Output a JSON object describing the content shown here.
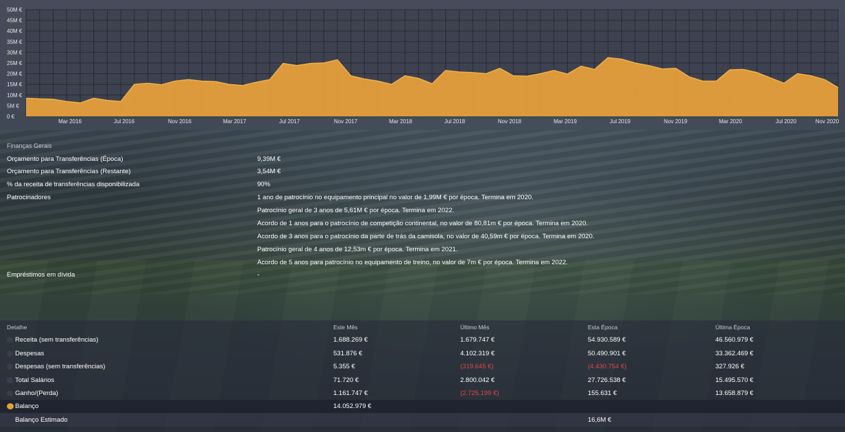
{
  "chart_data": {
    "type": "area",
    "y_ticks": [
      "50M €",
      "45M €",
      "40M €",
      "35M €",
      "30M €",
      "25M €",
      "20M €",
      "15M €",
      "10M €",
      "5M €",
      "0 €"
    ],
    "x_ticks": [
      "Mar 2016",
      "Jul 2016",
      "Nov 2016",
      "Mar 2017",
      "Jul 2017",
      "Nov 2017",
      "Mar 2018",
      "Jul 2018",
      "Nov 2018",
      "Mar 2019",
      "Jul 2019",
      "Nov 2019",
      "Mar 2020",
      "Jul 2020",
      "Nov 2020"
    ],
    "ylim": [
      0,
      50
    ],
    "y_unit": "M €",
    "values": [
      8.5,
      8.2,
      8.0,
      7.0,
      6.3,
      8.5,
      7.5,
      7.0,
      15.0,
      15.5,
      14.8,
      16.5,
      17.2,
      16.5,
      16.3,
      15.0,
      14.5,
      16.0,
      17.2,
      24.8,
      23.8,
      24.8,
      25.0,
      26.5,
      19.0,
      17.5,
      16.5,
      15.0,
      19.0,
      17.8,
      15.3,
      21.5,
      20.8,
      20.5,
      20.0,
      22.5,
      19.0,
      18.8,
      20.0,
      21.5,
      19.8,
      23.5,
      22.0,
      27.5,
      26.8,
      25.0,
      23.8,
      22.2,
      22.5,
      18.5,
      16.5,
      16.5,
      21.8,
      22.0,
      20.5,
      18.0,
      15.5,
      20.0,
      19.0,
      17.2,
      13.5
    ],
    "fill_color": "#e9a23b",
    "grid": true
  },
  "finances": {
    "header": "Finanças Gerais",
    "rows": [
      {
        "label": "Orçamento para Transferências (Época)",
        "value": "9,39M €"
      },
      {
        "label": "Orçamento para Transferências (Restante)",
        "value": "3,54M €"
      },
      {
        "label": "% da receita de transferências disponibilizada",
        "value": "90%"
      }
    ],
    "sponsors_label": "Patrocinadores",
    "sponsors": [
      "1 ano de patrocínio no equipamento principal no valor de 1,99M € por época. Termina em 2020.",
      "Patrocínio geral de 3 anos de 5,61M € por época. Termina em 2022.",
      "Acordo de 1 anos para o patrocínio de competição continental, no valor de 80,81m € por época. Termina em 2020.",
      "Acordo de 3 anos para o patrocínio da parte de trás da camisola, no valor de 40,59m € por época. Termina em 2020.",
      "Patrocínio geral de 4 anos de 12,53m € por época. Termina em 2021.",
      "Acordo de 5 anos para patrocínio no equipamento de treino, no valor de 7m € por época. Termina em 2022."
    ],
    "loans_label": "Empréstimos em dívida",
    "loans_value": "-"
  },
  "detail": {
    "headers": [
      "Detalhe",
      "Este Mês",
      "Último Mês",
      "Esta Época",
      "Última Época"
    ],
    "rows": [
      {
        "label": "Receita (sem transferências)",
        "this_month": "1.688.269 €",
        "last_month": "1.679.747 €",
        "this_season": "54.930.589 €",
        "last_season": "46.560.979 €"
      },
      {
        "label": "Despesas",
        "this_month": "531.876 €",
        "last_month": "4.102.319 €",
        "this_season": "50.490.901 €",
        "last_season": "33.362.469 €"
      },
      {
        "label": "Despesas (sem transferências)",
        "this_month": "5.355 €",
        "last_month": "(319.645 €)",
        "this_season": "(4.430.754 €)",
        "last_season": "327.926 €"
      },
      {
        "label": "Total Salários",
        "this_month": "71.720 €",
        "last_month": "2.800.042 €",
        "this_season": "27.726.538 €",
        "last_season": "15.495.570 €"
      },
      {
        "label": "Ganho/(Perda)",
        "this_month": "1.161.747 €",
        "last_month": "(2.725.199 €)",
        "this_season": "155.631 €",
        "last_season": "13.658.879 €"
      }
    ],
    "balance_label": "Balanço",
    "balance_value": "14.052.979 €",
    "estimated_label": "Balanço Estimado",
    "estimated_value": "16,6M €",
    "negative_color": "#e0464b"
  }
}
